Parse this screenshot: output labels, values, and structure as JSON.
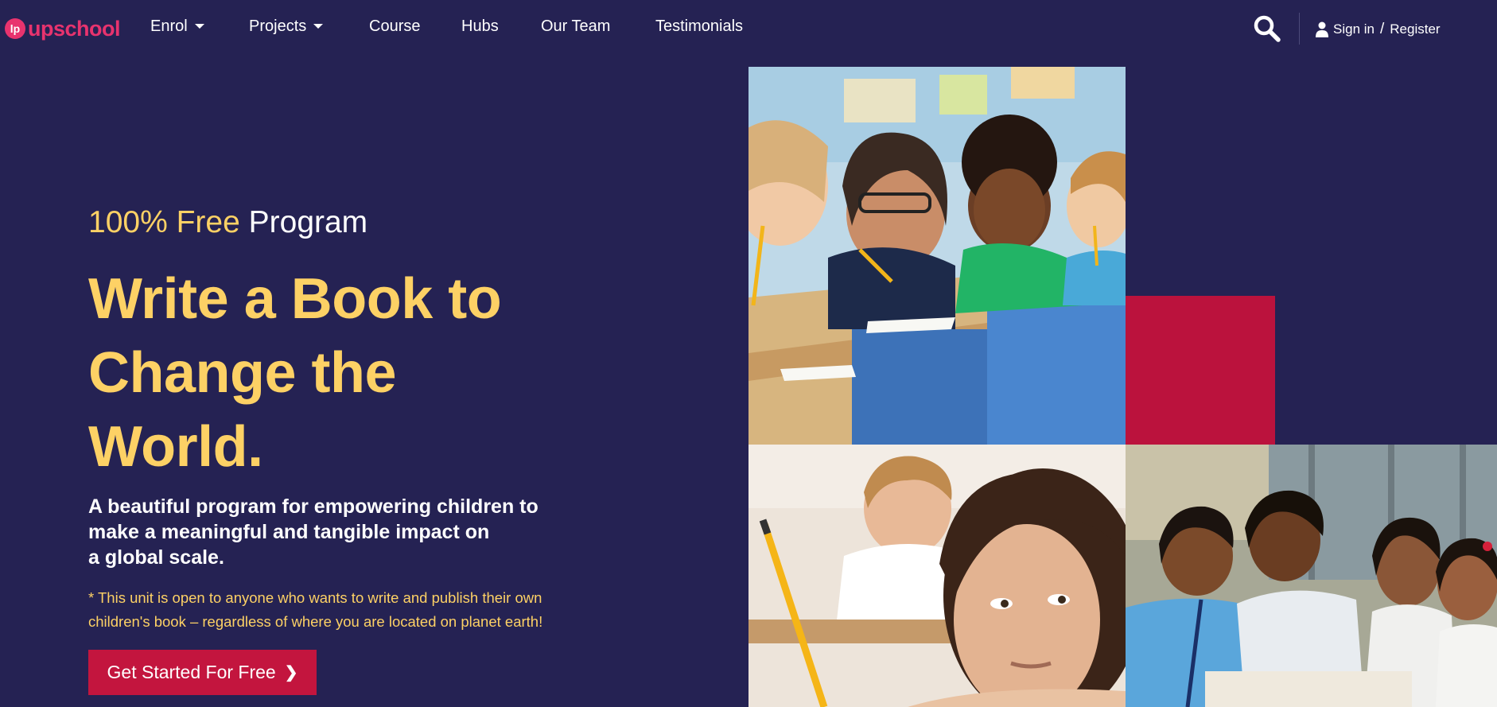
{
  "brand": {
    "name": "upschool",
    "mark": "lp",
    "color": "#e8336e"
  },
  "nav": {
    "items": [
      {
        "label": "Enrol",
        "dropdown": true
      },
      {
        "label": "Projects",
        "dropdown": true
      },
      {
        "label": "Course",
        "dropdown": false
      },
      {
        "label": "Hubs",
        "dropdown": false
      },
      {
        "label": "Our Team",
        "dropdown": false
      },
      {
        "label": "Testimonials",
        "dropdown": false
      }
    ],
    "search_icon": "search-icon",
    "signin_label": "Sign in",
    "separator": "/",
    "register_label": "Register",
    "user_icon": "user-icon"
  },
  "hero": {
    "tag_highlight": "100% Free",
    "tag_rest": "Program",
    "headline_lines": [
      "Write a Book to",
      "Change the",
      "World."
    ],
    "sub_lines": [
      "A beautiful program for empowering children to",
      "make a meaningful and tangible impact on",
      "a global scale."
    ],
    "note_lines": [
      "* This unit is open to anyone who wants to write and publish their own",
      "children's book – regardless of where you are located on planet earth!"
    ],
    "cta_label": "Get Started For Free",
    "cta_icon": "chevron-right-icon"
  },
  "colors": {
    "background": "#252253",
    "accent_yellow": "#fdd165",
    "accent_red": "#bb123d",
    "button_red": "#c3153e"
  },
  "images": [
    {
      "name": "classroom-children-photo",
      "description": "children at classroom desks"
    },
    {
      "name": "girl-thinking-photo",
      "description": "girl with pencil thinking"
    },
    {
      "name": "students-reading-photo",
      "description": "students looking at a book"
    }
  ]
}
